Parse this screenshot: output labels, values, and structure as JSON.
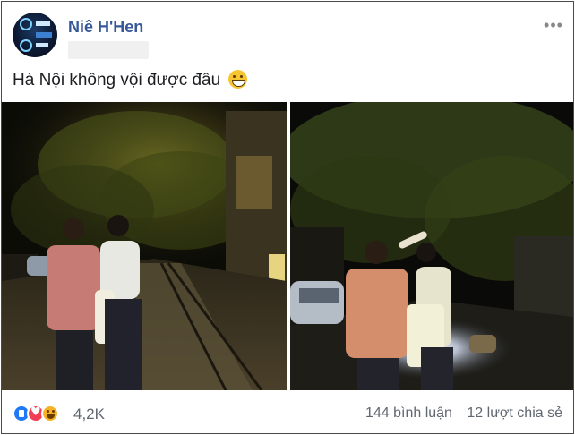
{
  "post": {
    "author_name": "Niê H'Hen",
    "text": "Hà Nội không vội được đâu",
    "text_emoji": "grinning-face-icon",
    "photos": [
      {
        "description_icon": "night-street-photo-1"
      },
      {
        "description_icon": "night-street-photo-2"
      }
    ]
  },
  "footer": {
    "reaction_icons": [
      "like-icon",
      "love-icon",
      "haha-icon"
    ],
    "reaction_count": "4,2K",
    "comments": "144 bình luận",
    "shares": "12 lượt chia sẻ"
  },
  "colors": {
    "author": "#365899",
    "like": "#2078f4",
    "love": "#f33e58",
    "haha": "#f7b125",
    "secondary_text": "#606770"
  }
}
